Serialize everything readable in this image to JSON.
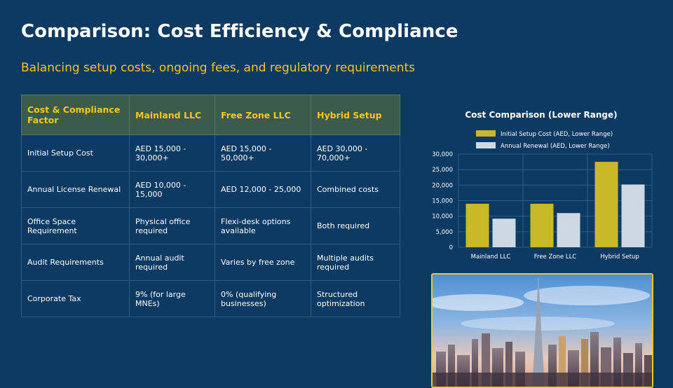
{
  "slide": {
    "title": "Comparison: Cost Efficiency & Compliance",
    "subtitle": "Balancing setup costs, ongoing fees, and regulatory requirements"
  },
  "table": {
    "headers": [
      "Cost & Compliance Factor",
      "Mainland LLC",
      "Free Zone LLC",
      "Hybrid Setup"
    ],
    "rows": [
      [
        "Initial Setup Cost",
        "AED 15,000 - 30,000+",
        "AED 15,000 - 50,000+",
        "AED 30,000 - 70,000+"
      ],
      [
        "Annual License Renewal",
        "AED 10,000 - 15,000",
        "AED 12,000 - 25,000",
        "Combined costs"
      ],
      [
        "Office Space Requirement",
        "Physical office required",
        "Flexi-desk options available",
        "Both required"
      ],
      [
        "Audit Requirements",
        "Annual audit required",
        "Varies by free zone",
        "Multiple audits required"
      ],
      [
        "Corporate Tax",
        "9% (for large MNEs)",
        "0% (qualifying businesses)",
        "Structured optimization"
      ]
    ]
  },
  "colors": {
    "background": "#0d3a63",
    "accent": "#f2c81d",
    "series_1": "#c9b92a",
    "series_2": "#cdd8e2"
  },
  "chart_data": {
    "type": "bar",
    "title": "Cost Comparison (Lower Range)",
    "categories": [
      "Mainland LLC",
      "Free Zone LLC",
      "Hybrid Setup"
    ],
    "series": [
      {
        "name": "Initial Setup Cost (AED, Lower Range)",
        "values": [
          14000,
          14000,
          27500
        ]
      },
      {
        "name": "Annual Renewal (AED, Lower Range)",
        "values": [
          9200,
          11000,
          20200
        ]
      }
    ],
    "yticks": [
      "30,000",
      "25,000",
      "20,000",
      "15,000",
      "10,000",
      "5,000",
      "0"
    ],
    "ylim": [
      0,
      30000
    ],
    "legend": "top",
    "grid": true
  },
  "photo": {
    "subject": "city skyline photo"
  }
}
